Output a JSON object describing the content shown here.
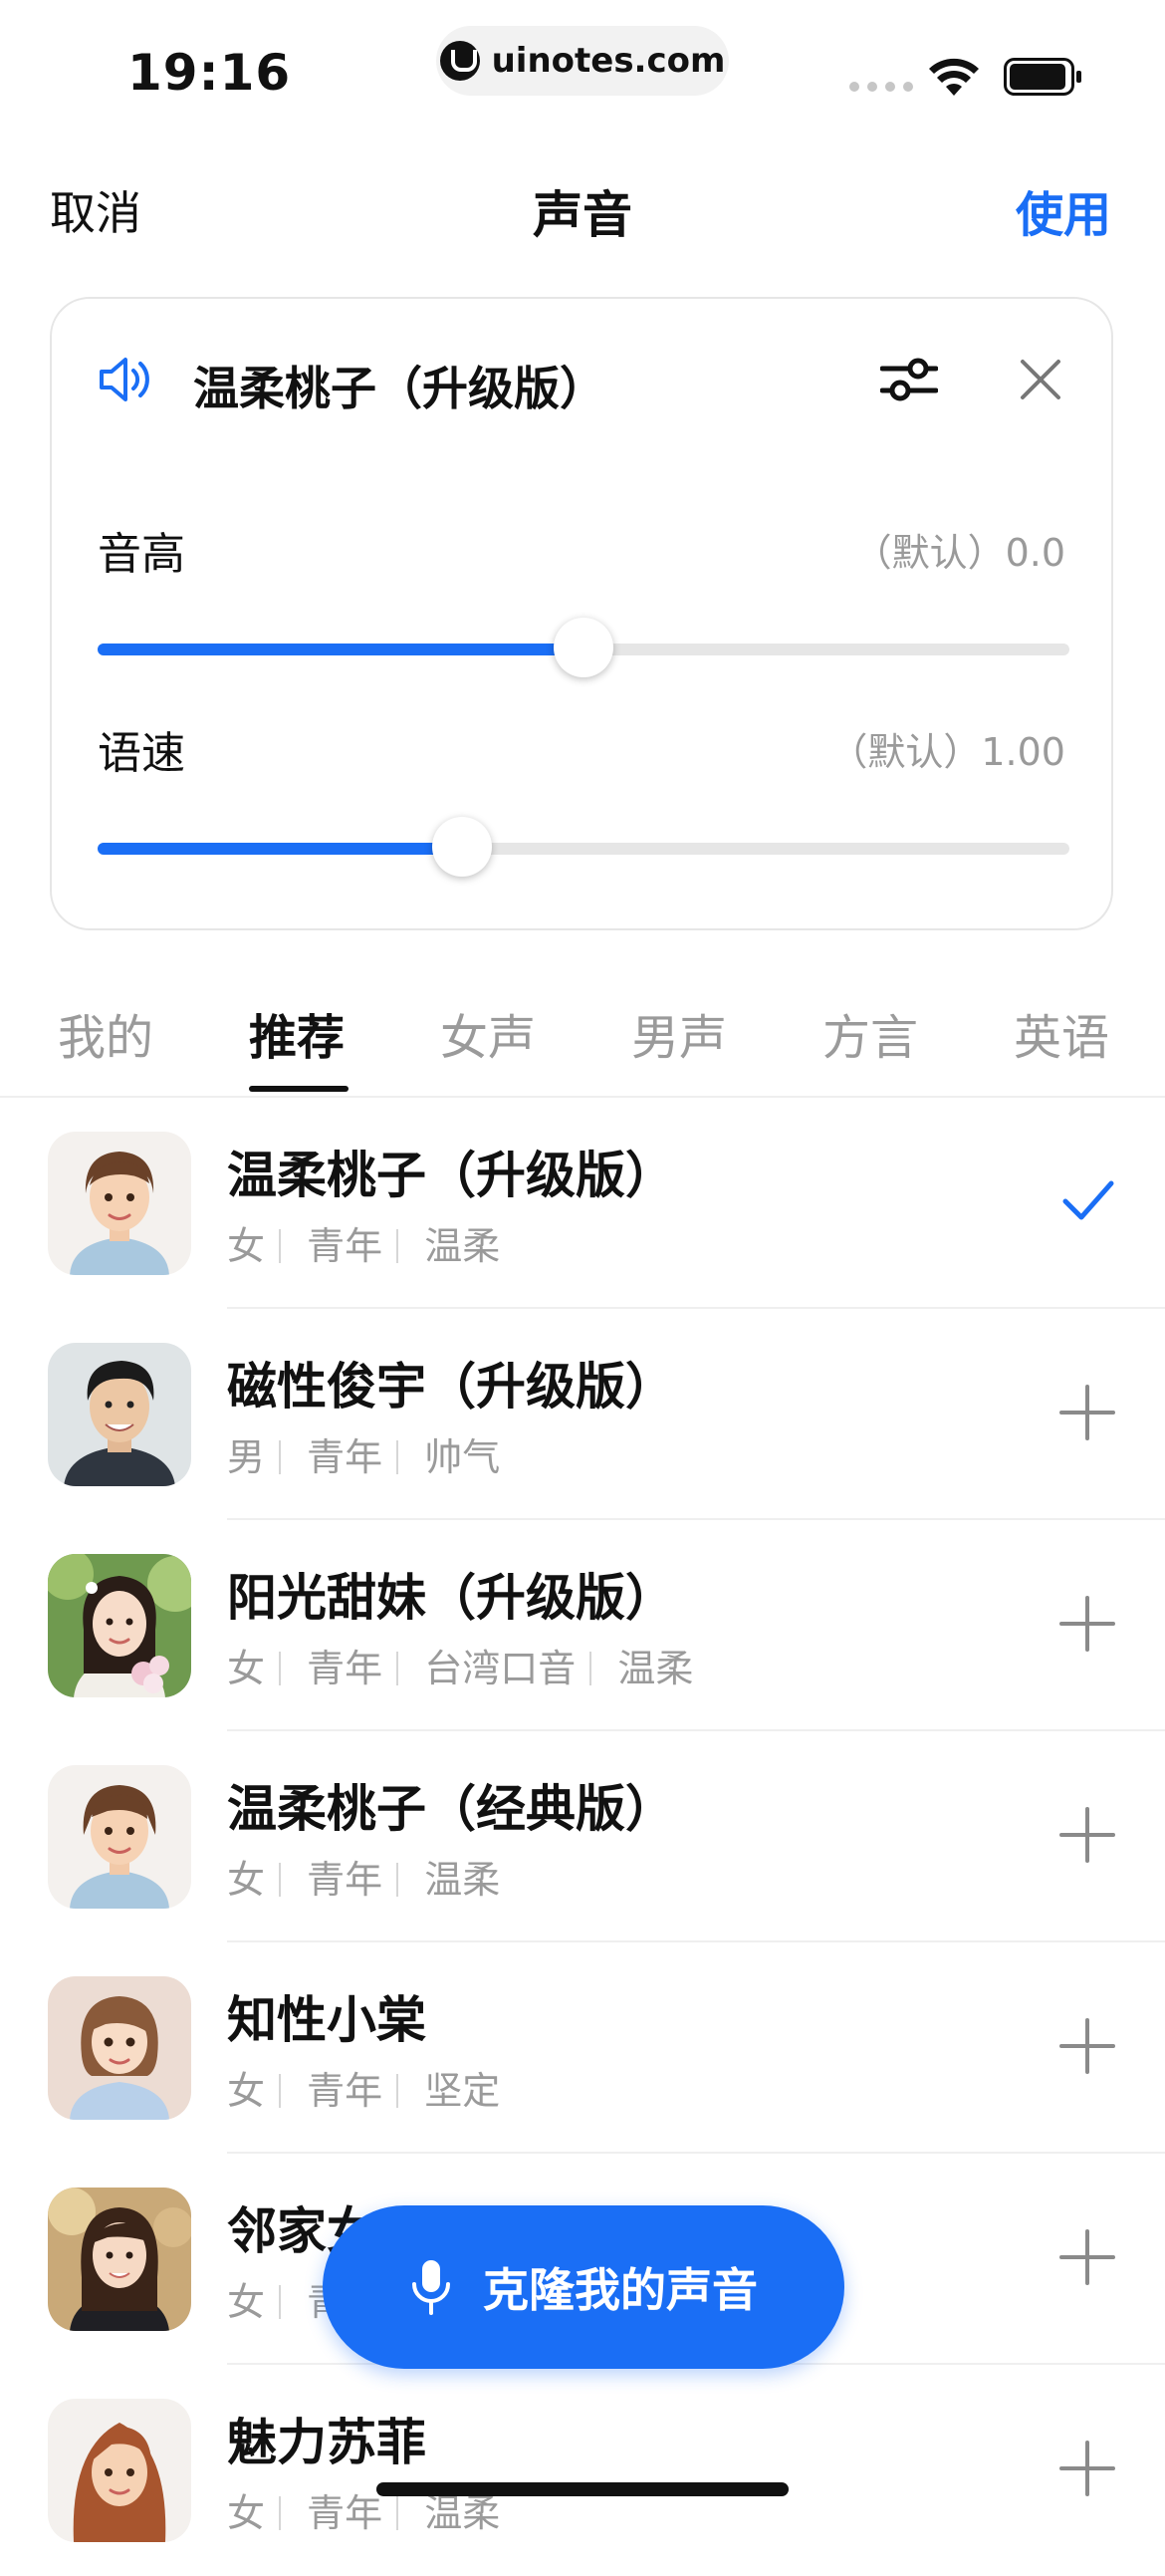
{
  "status_bar": {
    "time": "19:16",
    "url": "uinotes.com"
  },
  "nav": {
    "cancel": "取消",
    "title": "声音",
    "use": "使用"
  },
  "voice_card": {
    "voice_name": "温柔桃子（升级版）",
    "pitch": {
      "label": "音高",
      "value": "（默认）0.0",
      "position": 0.5
    },
    "speed": {
      "label": "语速",
      "value": "（默认）1.00",
      "position": 0.375
    }
  },
  "tabs": [
    {
      "label": "我的",
      "active": false
    },
    {
      "label": "推荐",
      "active": true
    },
    {
      "label": "女声",
      "active": false
    },
    {
      "label": "男声",
      "active": false
    },
    {
      "label": "方言",
      "active": false
    },
    {
      "label": "英语",
      "active": false
    }
  ],
  "voices": [
    {
      "name": "温柔桃子（升级版）",
      "tags": [
        "女",
        "青年",
        "温柔"
      ],
      "selected": true
    },
    {
      "name": "磁性俊宇（升级版）",
      "tags": [
        "男",
        "青年",
        "帅气"
      ],
      "selected": false
    },
    {
      "name": "阳光甜妹（升级版）",
      "tags": [
        "女",
        "青年",
        "台湾口音",
        "温柔"
      ],
      "selected": false
    },
    {
      "name": "温柔桃子（经典版）",
      "tags": [
        "女",
        "青年",
        "温柔"
      ],
      "selected": false
    },
    {
      "name": "知性小棠",
      "tags": [
        "女",
        "青年",
        "坚定"
      ],
      "selected": false
    },
    {
      "name": "邻家女",
      "tags": [
        "女",
        "青"
      ],
      "selected": false
    },
    {
      "name": "魅力苏菲",
      "tags": [
        "女",
        "青年",
        "温柔"
      ],
      "selected": false
    }
  ],
  "clone_button": {
    "label": "克隆我的声音"
  },
  "colors": {
    "accent": "#1a6ef5",
    "text": "#111111",
    "muted": "#9a9a9a"
  }
}
